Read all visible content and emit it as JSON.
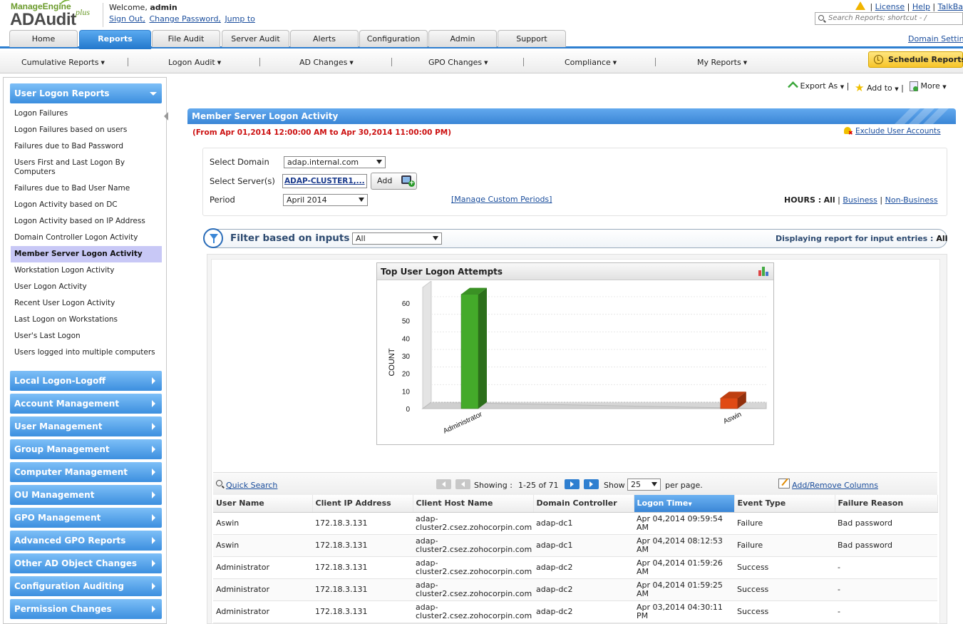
{
  "header": {
    "logo_brand": "ManageEngine",
    "logo_product": "ADAudit",
    "logo_plus": "plus",
    "welcome_prefix": "Welcome, ",
    "user": "admin",
    "links": [
      "Sign Out,",
      "Change Password,",
      "Jump to"
    ],
    "right_links": [
      "License",
      "Help",
      "TalkBa"
    ],
    "search_placeholder": "Search Reports; shortcut - /"
  },
  "tabs": [
    "Home",
    "Reports",
    "File Audit",
    "Server Audit",
    "Alerts",
    "Configuration",
    "Admin",
    "Support"
  ],
  "active_tab": "Reports",
  "domain_settings": "Domain Settin",
  "subnav": [
    "Cumulative Reports",
    "Logon Audit",
    "AD Changes",
    "GPO Changes",
    "Compliance",
    "My Reports"
  ],
  "schedule_reports": "Schedule Reports",
  "sidebar": {
    "open_section": "User Logon Reports",
    "items": [
      "Logon Failures",
      "Logon Failures based on users",
      "Failures due to Bad Password",
      "Users First and Last Logon By Computers",
      "Failures due to Bad User Name",
      "Logon Activity based on DC",
      "Logon Activity based on IP Address",
      "Domain Controller Logon Activity",
      "Member Server Logon Activity",
      "Workstation Logon Activity",
      "User Logon Activity",
      "Recent User Logon Activity",
      "Last Logon on Workstations",
      "User's Last Logon",
      "Users logged into multiple computers"
    ],
    "active_item": "Member Server Logon Activity",
    "sections": [
      "Local Logon-Logoff",
      "Account Management",
      "User Management",
      "Group Management",
      "Computer Management",
      "OU Management",
      "GPO Management",
      "Advanced GPO Reports",
      "Other AD Object Changes",
      "Configuration Auditing",
      "Permission Changes"
    ]
  },
  "toolbar": {
    "export": "Export As",
    "add_to": "Add to",
    "more": "More"
  },
  "report": {
    "title": "Member Server Logon Activity",
    "date_range": "(From Apr 01,2014 12:00:00 AM to Apr 30,2014 11:00:00 PM)",
    "exclude_link": "Exclude User Accounts",
    "select_domain_label": "Select Domain",
    "domain_value": "adap.internal.com",
    "select_servers_label": "Select Server(s)",
    "servers_value": "ADAP-CLUSTER1,...",
    "add_button": "Add",
    "period_label": "Period",
    "period_value": "April 2014",
    "manage_periods": "[Manage Custom Periods]",
    "hours_label": "HOURS :",
    "hours_all": "All",
    "hours_business": "Business",
    "hours_nonbusiness": "Non-Business",
    "filter_label": "Filter based on inputs",
    "filter_value": "All",
    "displaying_label": "Displaying report for input entries :",
    "displaying_value": "All"
  },
  "chart_data": {
    "type": "bar",
    "title": "Top User Logon Attempts",
    "categories": [
      "Administrator",
      "Aswin"
    ],
    "values": [
      65,
      6
    ],
    "xlabel": "",
    "ylabel": "COUNT",
    "ylim": [
      0,
      60
    ],
    "yticks": [
      "0",
      "10",
      "20",
      "30",
      "40",
      "50",
      "60"
    ],
    "colors": [
      "#44aa2a",
      "#e04a14"
    ],
    "grid": true,
    "style": "3d"
  },
  "table": {
    "quick_search": "Quick Search",
    "showing_label": "Showing :",
    "showing_range": "1-25 of 71",
    "show_label": "Show",
    "per_page_value": "25",
    "per_page_suffix": "per page.",
    "add_remove_columns": "Add/Remove Columns",
    "columns": [
      "User Name",
      "Client IP Address",
      "Client Host Name",
      "Domain Controller",
      "Logon Time",
      "Event Type",
      "Failure Reason"
    ],
    "sorted_column": "Logon Time",
    "rows": [
      [
        "Aswin",
        "172.18.3.131",
        "adap-cluster2.csez.zohocorpin.com",
        "adap-dc1",
        "Apr 04,2014 09:59:54 AM",
        "Failure",
        "Bad password"
      ],
      [
        "Aswin",
        "172.18.3.131",
        "adap-cluster2.csez.zohocorpin.com",
        "adap-dc1",
        "Apr 04,2014 08:12:53 AM",
        "Failure",
        "Bad password"
      ],
      [
        "Administrator",
        "172.18.3.131",
        "adap-cluster2.csez.zohocorpin.com",
        "adap-dc2",
        "Apr 04,2014 01:59:26 AM",
        "Success",
        "-"
      ],
      [
        "Administrator",
        "172.18.3.131",
        "adap-cluster2.csez.zohocorpin.com",
        "adap-dc2",
        "Apr 04,2014 01:59:25 AM",
        "Success",
        "-"
      ],
      [
        "Administrator",
        "172.18.3.131",
        "adap-cluster2.csez.zohocorpin.com",
        "adap-dc2",
        "Apr 03,2014 04:30:11 PM",
        "Success",
        "-"
      ]
    ]
  }
}
